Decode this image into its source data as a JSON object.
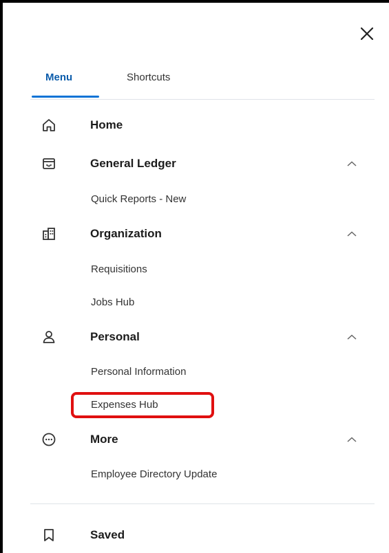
{
  "header": {
    "close_icon": "close-icon"
  },
  "tabs": [
    {
      "label": "Menu",
      "active": true
    },
    {
      "label": "Shortcuts",
      "active": false
    }
  ],
  "menu": {
    "home": {
      "label": "Home",
      "icon": "home-icon"
    },
    "general_ledger": {
      "label": "General Ledger",
      "icon": "inbox-tray-icon",
      "expanded": true,
      "items": [
        "Quick Reports - New"
      ]
    },
    "organization": {
      "label": "Organization",
      "icon": "building-icon",
      "expanded": true,
      "items": [
        "Requisitions",
        "Jobs Hub"
      ]
    },
    "personal": {
      "label": "Personal",
      "icon": "person-icon",
      "expanded": true,
      "items": [
        "Personal Information",
        "Expenses Hub"
      ]
    },
    "more": {
      "label": "More",
      "icon": "more-circle-icon",
      "expanded": true,
      "items": [
        "Employee Directory Update"
      ]
    },
    "saved": {
      "label": "Saved",
      "icon": "bookmark-icon"
    }
  },
  "colors": {
    "accent": "#0b73d6",
    "active_tab_text": "#0b5cab",
    "highlight": "#e01010",
    "text": "#1c1c1c",
    "subtext": "#333333",
    "divider": "#dfe3e8"
  }
}
